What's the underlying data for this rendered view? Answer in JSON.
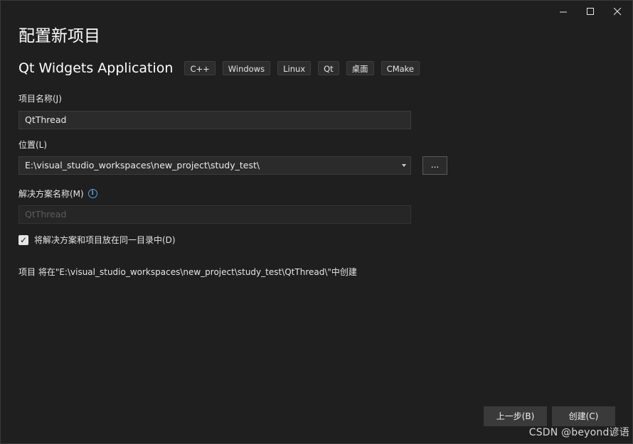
{
  "window": {
    "controls": {
      "minimize": "—",
      "maximize": "☐",
      "close": "✕"
    }
  },
  "page_title": "配置新项目",
  "template": {
    "name": "Qt Widgets Application",
    "tags": [
      "C++",
      "Windows",
      "Linux",
      "Qt",
      "桌面",
      "CMake"
    ]
  },
  "project_name": {
    "label": "项目名称(J)",
    "value": "QtThread"
  },
  "location": {
    "label": "位置(L)",
    "value": "E:\\visual_studio_workspaces\\new_project\\study_test\\",
    "browse_label": "..."
  },
  "solution_name": {
    "label": "解决方案名称(M)",
    "info_icon": "i",
    "value": "QtThread"
  },
  "same_directory": {
    "checked_mark": "✓",
    "label": "将解决方案和项目放在同一目录中(D)"
  },
  "summary": "项目 将在\"E:\\visual_studio_workspaces\\new_project\\study_test\\QtThread\\\"中创建",
  "footer": {
    "back_label": "上一步(B)",
    "create_label": "创建(C)"
  },
  "watermark": "CSDN @beyond谚语"
}
